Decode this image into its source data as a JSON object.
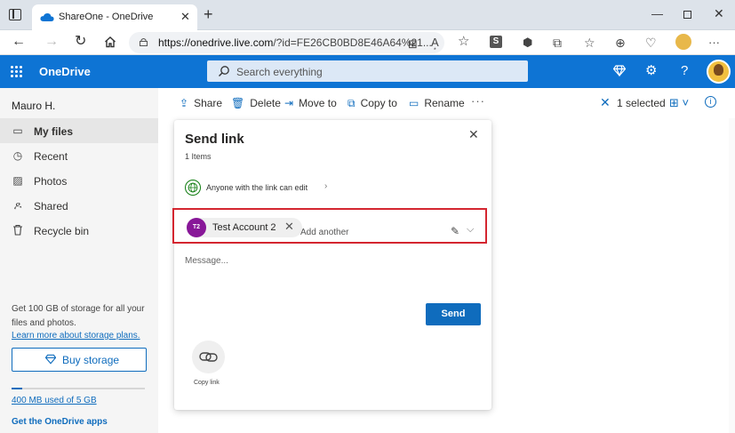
{
  "browser": {
    "tab_title": "ShareOne - OneDrive",
    "tab_close": "✕",
    "new_tab": "+",
    "url_domain": "https://onedrive.live.com",
    "url_path": "/?id=FE26CB0BD8E46A64%21...",
    "win_min": "—",
    "win_close": "✕",
    "ext_s_label": "S",
    "more_label": "···"
  },
  "appbar": {
    "app_name": "OneDrive",
    "search_placeholder": "Search everything",
    "help_label": "?"
  },
  "sidebar": {
    "user_name": "Mauro H.",
    "items": [
      {
        "label": "My files",
        "icon": "folder-icon",
        "glyph": "▭",
        "active": true
      },
      {
        "label": "Recent",
        "icon": "clock-icon",
        "glyph": "◷",
        "active": false
      },
      {
        "label": "Photos",
        "icon": "image-icon",
        "glyph": "▨",
        "active": false
      },
      {
        "label": "Shared",
        "icon": "people-icon",
        "glyph": "ዶ",
        "active": false
      },
      {
        "label": "Recycle bin",
        "icon": "trash-icon",
        "glyph": "🗑",
        "active": false
      }
    ],
    "storage_promo": "Get 100 GB of storage for all your files and photos.",
    "storage_plans_link": "Learn more about storage plans.",
    "buy_storage": "Buy storage",
    "quota_fraction": 0.08,
    "quota_text": "400 MB used of 5 GB",
    "get_apps": "Get the OneDrive apps"
  },
  "command_bar": {
    "share": "Share",
    "delete": "Delete",
    "move_to": "Move to",
    "copy_to": "Copy to",
    "rename": "Rename",
    "more": "···",
    "selected_text": "1 selected",
    "info_label": "i"
  },
  "dialog": {
    "title": "Send link",
    "item_count": "1 Items",
    "permission": "Anyone with the link can edit",
    "permission_chevron": "›",
    "recipient_initials": "T2",
    "recipient_name": "Test Account 2",
    "add_another_placeholder": "Add another",
    "message_placeholder": "Message...",
    "send": "Send",
    "copy_link": "Copy link",
    "close": "✕",
    "chip_remove": "✕"
  },
  "colors": {
    "brand_blue": "#0e74d4",
    "accent_blue": "#0f6cbd",
    "highlight_red": "#d42630",
    "avatar_purple": "#881798"
  }
}
